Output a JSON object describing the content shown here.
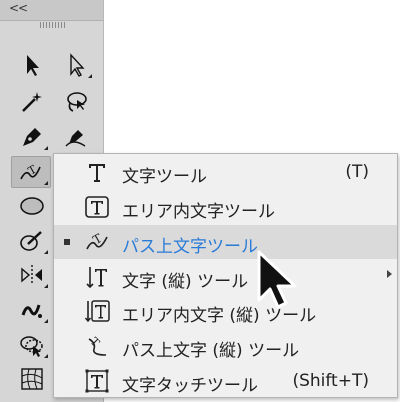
{
  "toolbar": {
    "collapse_label": "<<",
    "tools": [
      {
        "name": "selection-tool",
        "icon": "selection-arrow-icon"
      },
      {
        "name": "direct-selection-tool",
        "icon": "direct-selection-icon"
      },
      {
        "name": "magic-wand-tool",
        "icon": "magic-wand-icon"
      },
      {
        "name": "lasso-tool",
        "icon": "lasso-icon"
      },
      {
        "name": "pen-tool",
        "icon": "pen-icon"
      },
      {
        "name": "curvature-tool",
        "icon": "curvature-icon"
      },
      {
        "name": "type-on-path-tool",
        "icon": "type-on-path-icon"
      },
      {
        "name": "ellipse-tool",
        "icon": "ellipse-icon"
      },
      {
        "name": "shaper-tool",
        "icon": "shaper-icon"
      },
      {
        "name": "reflect-tool",
        "icon": "reflect-icon"
      },
      {
        "name": "warp-tool",
        "icon": "warp-icon"
      },
      {
        "name": "shape-builder-tool",
        "icon": "shape-builder-icon"
      },
      {
        "name": "mesh-tool",
        "icon": "mesh-icon"
      }
    ]
  },
  "flyout": {
    "items": [
      {
        "label": "文字ツール",
        "shortcut": "(T)",
        "icon": "type-icon",
        "selected": false
      },
      {
        "label": "エリア内文字ツール",
        "shortcut": "",
        "icon": "area-type-icon",
        "selected": false
      },
      {
        "label": "パス上文字ツール",
        "shortcut": "",
        "icon": "type-on-path-icon",
        "selected": true
      },
      {
        "label": "文字 (縦) ツール",
        "shortcut": "",
        "icon": "vertical-type-icon",
        "selected": false
      },
      {
        "label": "エリア内文字 (縦) ツール",
        "shortcut": "",
        "icon": "vertical-area-type-icon",
        "selected": false
      },
      {
        "label": "パス上文字 (縦) ツール",
        "shortcut": "",
        "icon": "vertical-type-on-path-icon",
        "selected": false
      },
      {
        "label": "文字タッチツール",
        "shortcut": "(Shift+T)",
        "icon": "touch-type-icon",
        "selected": false
      }
    ]
  },
  "colors": {
    "selected_text": "#2a7bd8",
    "menu_bg": "#f0f0f0",
    "toolbar_bg": "#d6d6d6"
  }
}
